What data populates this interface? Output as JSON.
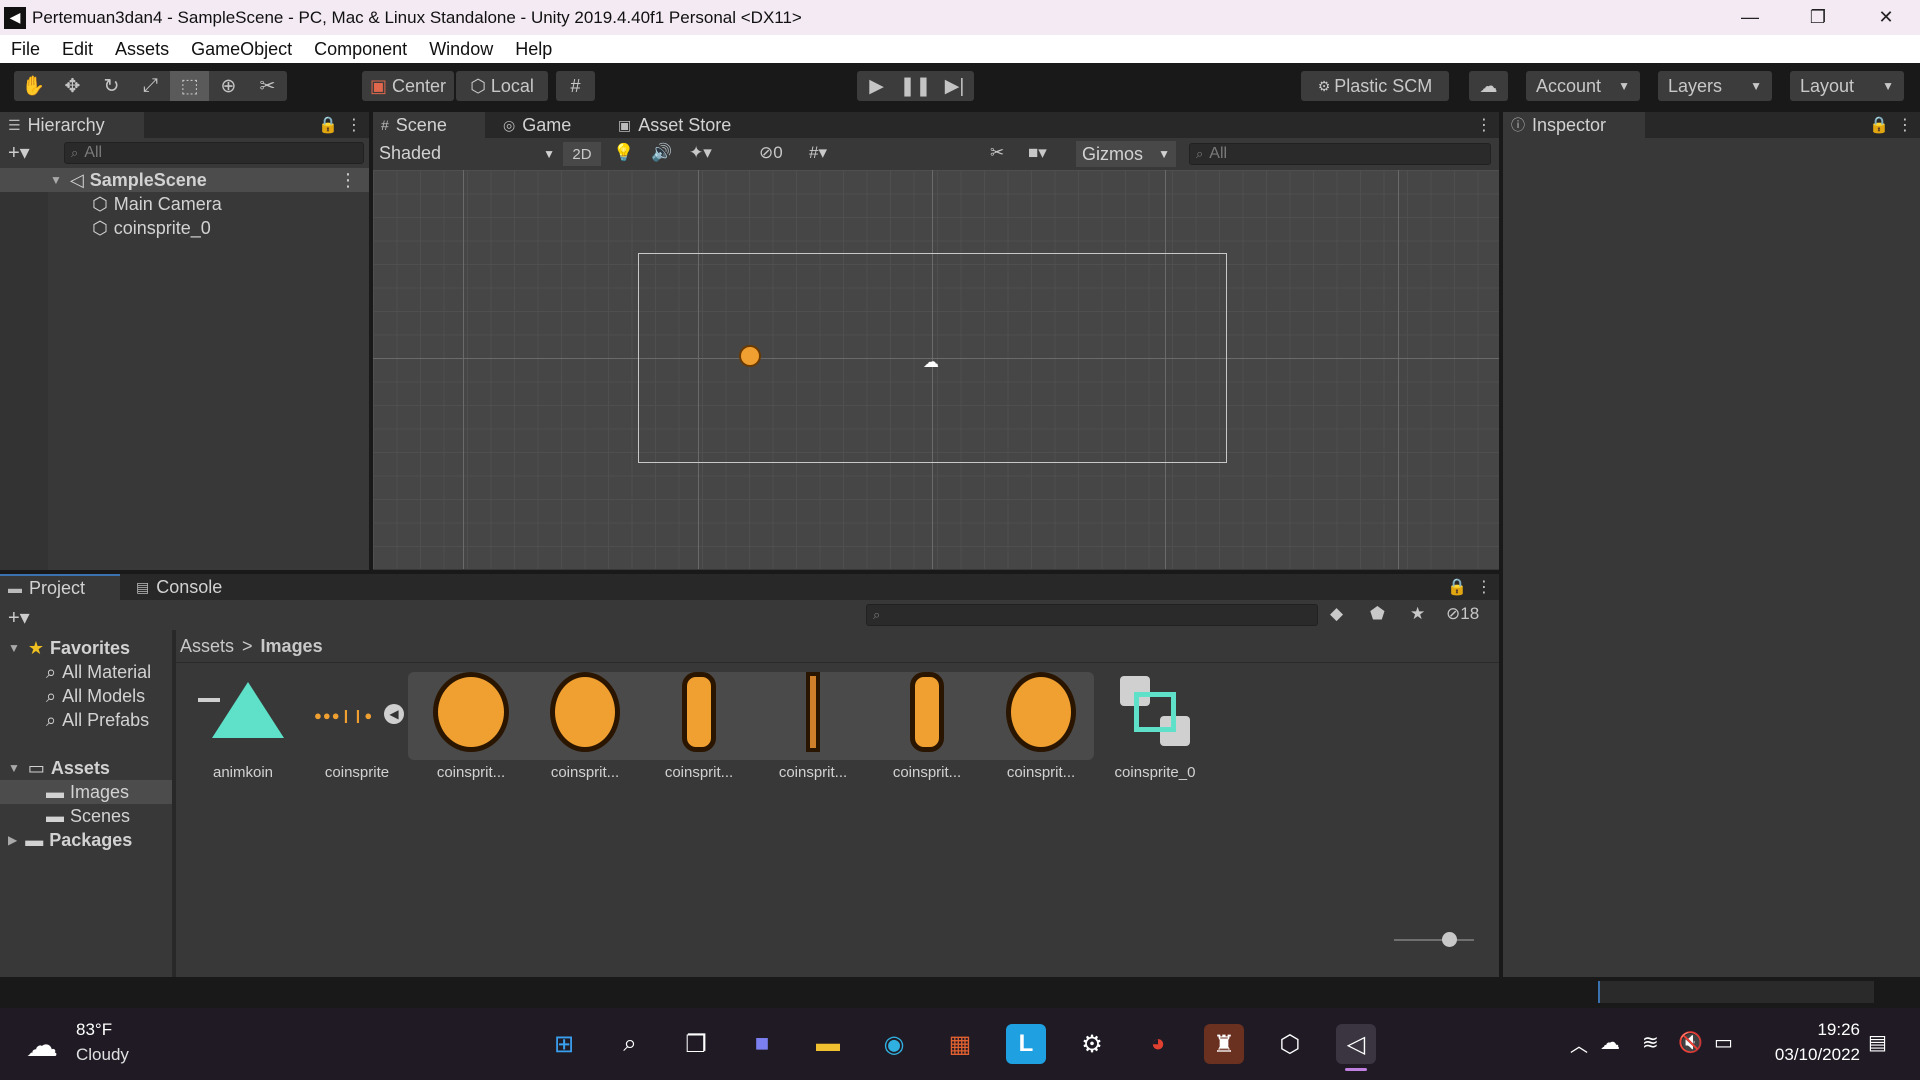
{
  "window": {
    "title": "Pertemuan3dan4 - SampleScene - PC, Mac & Linux Standalone - Unity 2019.4.40f1 Personal <DX11>",
    "controls": [
      "—",
      "❐",
      "✕"
    ]
  },
  "menu": [
    "File",
    "Edit",
    "Assets",
    "GameObject",
    "Component",
    "Window",
    "Help"
  ],
  "toolbar": {
    "tools": [
      "hand-tool",
      "move-tool",
      "rotate-tool",
      "scale-tool",
      "rect-tool",
      "transform-tool",
      "custom-tool"
    ],
    "active_tool_index": 4,
    "pivot_label": "Center",
    "space_label": "Local",
    "plastic_label": "Plastic SCM",
    "account_label": "Account",
    "layers_label": "Layers",
    "layout_label": "Layout"
  },
  "hierarchy": {
    "tab": "Hierarchy",
    "search_placeholder": "All",
    "scene": "SampleScene",
    "objects": [
      "Main Camera",
      "coinsprite_0"
    ]
  },
  "scene_tabs": [
    "Scene",
    "Game",
    "Asset Store"
  ],
  "scene_toolbar": {
    "shading": "Shaded",
    "mode_2d": "2D",
    "hidden_count": "0",
    "gizmos": "Gizmos",
    "search_placeholder": "All"
  },
  "inspector": {
    "tab": "Inspector"
  },
  "bottom_tabs": [
    "Project",
    "Console"
  ],
  "project": {
    "hidden_count": "18",
    "favorites_label": "Favorites",
    "favorites": [
      "All Material",
      "All Models",
      "All Prefabs"
    ],
    "assets_label": "Assets",
    "asset_folders": [
      "Images",
      "Scenes"
    ],
    "packages_label": "Packages",
    "breadcrumb": [
      "Assets",
      "Images"
    ],
    "breadcrumb_sep": ">",
    "items": [
      "animkoin",
      "coinsprite",
      "coinsprit...",
      "coinsprit...",
      "coinsprit...",
      "coinsprit...",
      "coinsprit...",
      "coinsprit...",
      "coinsprite_0"
    ]
  },
  "taskbar": {
    "weather_temp": "83°F",
    "weather_desc": "Cloudy",
    "time": "19:26",
    "date": "03/10/2022",
    "apps": [
      "start-icon",
      "search-icon",
      "task-view-icon",
      "chat-icon",
      "file-explorer-icon",
      "edge-icon",
      "store-icon",
      "l-app-icon",
      "steam-icon",
      "chrome-icon",
      "game-icon",
      "unity-hub-icon",
      "unity-icon"
    ]
  },
  "colors": {
    "editor_bg": "#383838",
    "dark_bg": "#282828",
    "accent_blue": "#3a72b0",
    "coin_orange": "#f0a030",
    "animator_teal": "#5fe0c8"
  }
}
